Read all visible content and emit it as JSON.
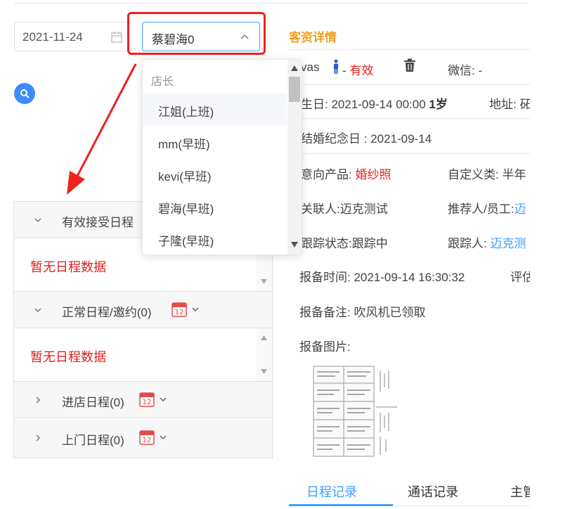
{
  "filters": {
    "date_value": "2021-11-24",
    "staff_value": "蔡碧海0"
  },
  "dropdown": {
    "group_title": "店长",
    "options": [
      "江姐(上班)",
      "mm(早班)",
      "kevi(早班)",
      "碧海(早班)",
      "子隆(早班)"
    ]
  },
  "schedule": {
    "sections": [
      {
        "title": "有效接受日程",
        "expanded": true,
        "empty_text": "暂无日程数据"
      },
      {
        "title": "正常日程/邀约(0)",
        "expanded": true,
        "empty_text": "暂无日程数据"
      },
      {
        "title": "进店日程(0)",
        "expanded": false
      },
      {
        "title": "上门日程(0)",
        "expanded": false
      }
    ]
  },
  "detail": {
    "title": "客资详情",
    "name": "vas",
    "status_sep": " - ",
    "status": "有效",
    "wechat": "微信: -",
    "birthday_label": "生日: 2021-09-14 00:00 ",
    "age": "1岁",
    "address_label": "地址: 砳",
    "anniversary": "结婚纪念日 : 2021-09-14",
    "intent_label": "意向产品: ",
    "intent_value": "婚纱照",
    "custom_label": "自定义类: 半年",
    "related": "关联人:迈克测试",
    "referrer_label": "推荐人/员工:",
    "referrer_value": "迈",
    "tracking_status": "跟踪状态:跟踪中",
    "tracker_label": "跟踪人: ",
    "tracker_value": "迈克测",
    "report_time": "报备时间: 2021-09-14 16:30:32",
    "rating_label": "评估",
    "report_note": "报备备注: 吹风机已领取",
    "report_image_label": "报备图片:"
  },
  "tabs": [
    "日程记录",
    "通话记录",
    "主管"
  ],
  "colors": {
    "accent": "#409eff",
    "highlight": "#f0211f",
    "detail_title": "#f0a020",
    "empty_text": "#e02020"
  }
}
